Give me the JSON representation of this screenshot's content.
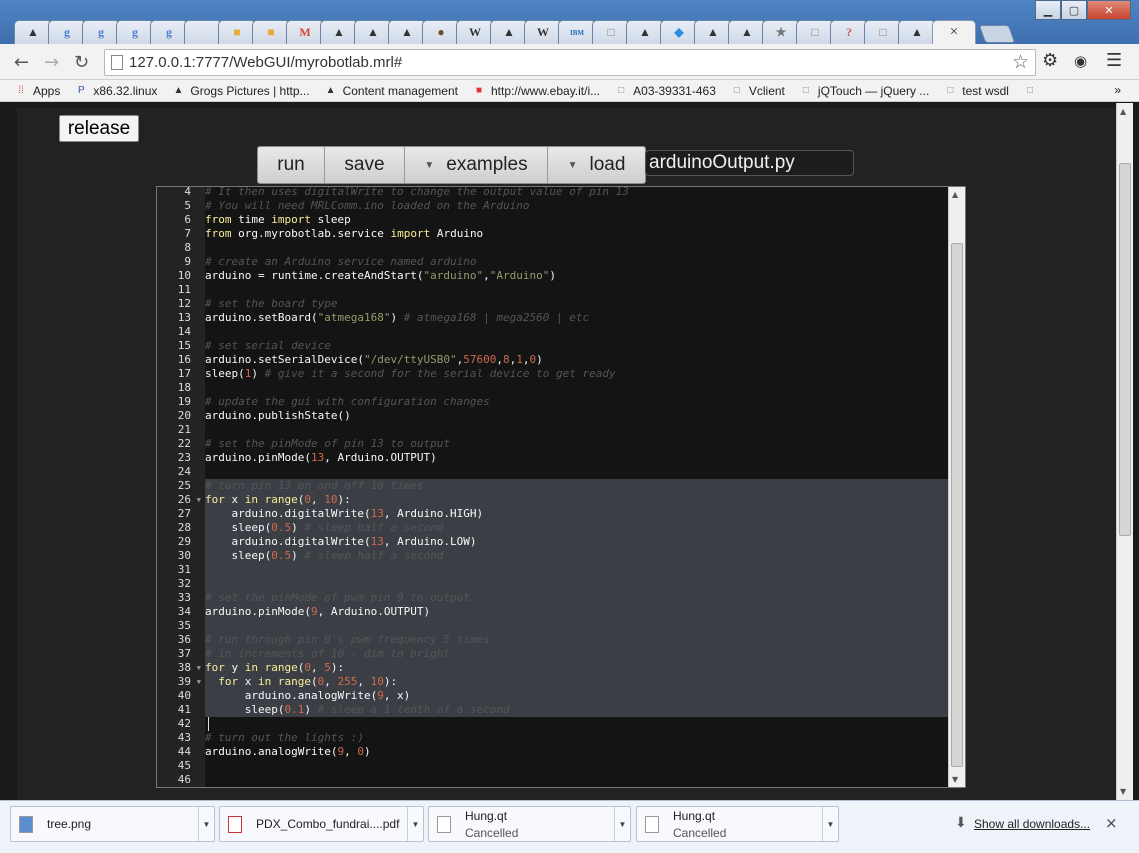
{
  "browser": {
    "tabs": [
      {
        "icon": "tophat-icon",
        "glyph": "▲",
        "color": "#333"
      },
      {
        "icon": "google-icon",
        "glyph": "g",
        "color": "#4a7fd8"
      },
      {
        "icon": "google-icon",
        "glyph": "g",
        "color": "#4a7fd8"
      },
      {
        "icon": "google-icon",
        "glyph": "g",
        "color": "#4a7fd8"
      },
      {
        "icon": "google-icon",
        "glyph": "g",
        "color": "#4a7fd8"
      },
      {
        "icon": "blank-icon",
        "glyph": "",
        "color": "#ccc"
      },
      {
        "icon": "box-icon",
        "glyph": "■",
        "color": "#e8a93a"
      },
      {
        "icon": "box-icon",
        "glyph": "■",
        "color": "#e8a93a"
      },
      {
        "icon": "gmail-icon",
        "glyph": "M",
        "color": "#d44638"
      },
      {
        "icon": "tophat-icon",
        "glyph": "▲",
        "color": "#333"
      },
      {
        "icon": "tophat-icon",
        "glyph": "▲",
        "color": "#333"
      },
      {
        "icon": "tophat-icon",
        "glyph": "▲",
        "color": "#333"
      },
      {
        "icon": "hedgehog-icon",
        "glyph": "●",
        "color": "#6b4a2a"
      },
      {
        "icon": "wikipedia-icon",
        "glyph": "W",
        "color": "#333"
      },
      {
        "icon": "tophat-icon",
        "glyph": "▲",
        "color": "#333"
      },
      {
        "icon": "wikipedia-icon",
        "glyph": "W",
        "color": "#333"
      },
      {
        "icon": "ibm-icon",
        "glyph": "IBM",
        "color": "#1f70c1"
      },
      {
        "icon": "page-icon",
        "glyph": "□",
        "color": "#888"
      },
      {
        "icon": "tophat-icon",
        "glyph": "▲",
        "color": "#333"
      },
      {
        "icon": "dropbox-icon",
        "glyph": "◆",
        "color": "#2a8ee0"
      },
      {
        "icon": "tophat-icon",
        "glyph": "▲",
        "color": "#333"
      },
      {
        "icon": "tophat-icon",
        "glyph": "▲",
        "color": "#333"
      },
      {
        "icon": "star-icon",
        "glyph": "★",
        "color": "#777"
      },
      {
        "icon": "page-icon",
        "glyph": "□",
        "color": "#888"
      },
      {
        "icon": "unknown-icon",
        "glyph": "?",
        "color": "#c55"
      },
      {
        "icon": "page-icon",
        "glyph": "□",
        "color": "#888"
      },
      {
        "icon": "tophat-icon",
        "glyph": "▲",
        "color": "#333"
      }
    ],
    "active_tab_close": "×",
    "url": "127.0.0.1:7777/WebGUI/myrobotlab.mrl#",
    "bookmarks": [
      {
        "icon": "apps-icon",
        "label": "Apps"
      },
      {
        "icon": "p-icon",
        "label": "x86.32.linux"
      },
      {
        "icon": "tophat-icon",
        "label": "Grogs Pictures | http..."
      },
      {
        "icon": "tophat-icon",
        "label": "Content management"
      },
      {
        "icon": "ebay-icon",
        "label": "http://www.ebay.it/i..."
      },
      {
        "icon": "page-icon",
        "label": "A03-39331-463"
      },
      {
        "icon": "page-icon",
        "label": "Vclient"
      },
      {
        "icon": "page-icon",
        "label": "jQTouch — jQuery ..."
      },
      {
        "icon": "page-icon",
        "label": "test wsdl"
      },
      {
        "icon": "page-icon",
        "label": ""
      }
    ],
    "bookmarks_more": "»"
  },
  "page": {
    "release_label": "release",
    "run_label": "run",
    "save_label": "save",
    "examples_label": "examples",
    "load_label": "load",
    "filename": "arduinoOutput.py"
  },
  "editor": {
    "cursor_line": 42,
    "lines": [
      {
        "n": 4,
        "sel": false,
        "fold": false,
        "toks": [
          [
            "c-com",
            "# It then uses digitalWrite to change the output value of pin 13"
          ]
        ]
      },
      {
        "n": 5,
        "sel": false,
        "fold": false,
        "toks": [
          [
            "c-com",
            "# You will need MRLComm.ino loaded on the Arduino"
          ]
        ]
      },
      {
        "n": 6,
        "sel": false,
        "fold": false,
        "toks": [
          [
            "c-kw",
            "from"
          ],
          [
            "c-id",
            " time "
          ],
          [
            "c-kw",
            "import"
          ],
          [
            "c-id",
            " sleep"
          ]
        ]
      },
      {
        "n": 7,
        "sel": false,
        "fold": false,
        "toks": [
          [
            "c-kw",
            "from"
          ],
          [
            "c-id",
            " org.myrobotlab.service "
          ],
          [
            "c-kw",
            "import"
          ],
          [
            "c-id",
            " Arduino"
          ]
        ]
      },
      {
        "n": 8,
        "sel": false,
        "fold": false,
        "toks": []
      },
      {
        "n": 9,
        "sel": false,
        "fold": false,
        "toks": [
          [
            "c-com",
            "# create an Arduino service named arduino"
          ]
        ]
      },
      {
        "n": 10,
        "sel": false,
        "fold": false,
        "toks": [
          [
            "c-id",
            "arduino = runtime.createAndStart("
          ],
          [
            "c-str",
            "\"arduino\""
          ],
          [
            "c-id",
            ","
          ],
          [
            "c-str",
            "\"Arduino\""
          ],
          [
            "c-id",
            ")"
          ]
        ]
      },
      {
        "n": 11,
        "sel": false,
        "fold": false,
        "toks": []
      },
      {
        "n": 12,
        "sel": false,
        "fold": false,
        "toks": [
          [
            "c-com",
            "# set the board type"
          ]
        ]
      },
      {
        "n": 13,
        "sel": false,
        "fold": false,
        "toks": [
          [
            "c-id",
            "arduino.setBoard("
          ],
          [
            "c-str",
            "\"atmega168\""
          ],
          [
            "c-id",
            ") "
          ],
          [
            "c-com",
            "# atmega168 | mega2560 | etc"
          ]
        ]
      },
      {
        "n": 14,
        "sel": false,
        "fold": false,
        "toks": []
      },
      {
        "n": 15,
        "sel": false,
        "fold": false,
        "toks": [
          [
            "c-com",
            "# set serial device"
          ]
        ]
      },
      {
        "n": 16,
        "sel": false,
        "fold": false,
        "toks": [
          [
            "c-id",
            "arduino.setSerialDevice("
          ],
          [
            "c-str",
            "\"/dev/ttyUSB0\""
          ],
          [
            "c-id",
            ","
          ],
          [
            "c-num",
            "57600"
          ],
          [
            "c-id",
            ","
          ],
          [
            "c-num",
            "8"
          ],
          [
            "c-id",
            ","
          ],
          [
            "c-num",
            "1"
          ],
          [
            "c-id",
            ","
          ],
          [
            "c-num",
            "0"
          ],
          [
            "c-id",
            ")"
          ]
        ]
      },
      {
        "n": 17,
        "sel": false,
        "fold": false,
        "toks": [
          [
            "c-id",
            "sleep("
          ],
          [
            "c-num",
            "1"
          ],
          [
            "c-id",
            ") "
          ],
          [
            "c-com",
            "# give it a second for the serial device to get ready"
          ]
        ]
      },
      {
        "n": 18,
        "sel": false,
        "fold": false,
        "toks": []
      },
      {
        "n": 19,
        "sel": false,
        "fold": false,
        "toks": [
          [
            "c-com",
            "# update the gui with configuration changes"
          ]
        ]
      },
      {
        "n": 20,
        "sel": false,
        "fold": false,
        "toks": [
          [
            "c-id",
            "arduino.publishState()"
          ]
        ]
      },
      {
        "n": 21,
        "sel": false,
        "fold": false,
        "toks": []
      },
      {
        "n": 22,
        "sel": false,
        "fold": false,
        "toks": [
          [
            "c-com",
            "# set the pinMode of pin 13 to output"
          ]
        ]
      },
      {
        "n": 23,
        "sel": false,
        "fold": false,
        "toks": [
          [
            "c-id",
            "arduino.pinMode("
          ],
          [
            "c-num",
            "13"
          ],
          [
            "c-id",
            ", Arduino.OUTPUT)"
          ]
        ]
      },
      {
        "n": 24,
        "sel": false,
        "fold": false,
        "toks": []
      },
      {
        "n": 25,
        "sel": true,
        "fold": false,
        "toks": [
          [
            "c-com",
            "# turn pin 13 on and off 10 times"
          ]
        ]
      },
      {
        "n": 26,
        "sel": true,
        "fold": true,
        "toks": [
          [
            "c-kw",
            "for"
          ],
          [
            "c-id",
            " x "
          ],
          [
            "c-kw",
            "in"
          ],
          [
            "c-id",
            " "
          ],
          [
            "c-kw",
            "range"
          ],
          [
            "c-id",
            "("
          ],
          [
            "c-num",
            "0"
          ],
          [
            "c-id",
            ", "
          ],
          [
            "c-num",
            "10"
          ],
          [
            "c-id",
            "):"
          ]
        ]
      },
      {
        "n": 27,
        "sel": true,
        "fold": false,
        "toks": [
          [
            "c-id",
            "    arduino.digitalWrite("
          ],
          [
            "c-num",
            "13"
          ],
          [
            "c-id",
            ", Arduino.HIGH)"
          ]
        ]
      },
      {
        "n": 28,
        "sel": true,
        "fold": false,
        "toks": [
          [
            "c-id",
            "    sleep("
          ],
          [
            "c-num",
            "0.5"
          ],
          [
            "c-id",
            ") "
          ],
          [
            "c-com",
            "# sleep half a second"
          ]
        ]
      },
      {
        "n": 29,
        "sel": true,
        "fold": false,
        "toks": [
          [
            "c-id",
            "    arduino.digitalWrite("
          ],
          [
            "c-num",
            "13"
          ],
          [
            "c-id",
            ", Arduino.LOW)"
          ]
        ]
      },
      {
        "n": 30,
        "sel": true,
        "fold": false,
        "toks": [
          [
            "c-id",
            "    sleep("
          ],
          [
            "c-num",
            "0.5"
          ],
          [
            "c-id",
            ") "
          ],
          [
            "c-com",
            "# sleep half a second"
          ]
        ]
      },
      {
        "n": 31,
        "sel": true,
        "fold": false,
        "toks": []
      },
      {
        "n": 32,
        "sel": true,
        "fold": false,
        "toks": []
      },
      {
        "n": 33,
        "sel": true,
        "fold": false,
        "toks": [
          [
            "c-com",
            "# set the pinMode of pwm pin 9 to output"
          ]
        ]
      },
      {
        "n": 34,
        "sel": true,
        "fold": false,
        "toks": [
          [
            "c-id",
            "arduino.pinMode("
          ],
          [
            "c-num",
            "9"
          ],
          [
            "c-id",
            ", Arduino.OUTPUT)"
          ]
        ]
      },
      {
        "n": 35,
        "sel": true,
        "fold": false,
        "toks": []
      },
      {
        "n": 36,
        "sel": true,
        "fold": false,
        "toks": [
          [
            "c-com",
            "# run through pin 9's pwm frequency 5 times"
          ]
        ]
      },
      {
        "n": 37,
        "sel": true,
        "fold": false,
        "toks": [
          [
            "c-com",
            "# in increments of 10 - dim to bright"
          ]
        ]
      },
      {
        "n": 38,
        "sel": true,
        "fold": true,
        "toks": [
          [
            "c-kw",
            "for"
          ],
          [
            "c-id",
            " y "
          ],
          [
            "c-kw",
            "in"
          ],
          [
            "c-id",
            " "
          ],
          [
            "c-kw",
            "range"
          ],
          [
            "c-id",
            "("
          ],
          [
            "c-num",
            "0"
          ],
          [
            "c-id",
            ", "
          ],
          [
            "c-num",
            "5"
          ],
          [
            "c-id",
            "):"
          ]
        ]
      },
      {
        "n": 39,
        "sel": true,
        "fold": true,
        "toks": [
          [
            "c-id",
            "  "
          ],
          [
            "c-kw",
            "for"
          ],
          [
            "c-id",
            " x "
          ],
          [
            "c-kw",
            "in"
          ],
          [
            "c-id",
            " "
          ],
          [
            "c-kw",
            "range"
          ],
          [
            "c-id",
            "("
          ],
          [
            "c-num",
            "0"
          ],
          [
            "c-id",
            ", "
          ],
          [
            "c-num",
            "255"
          ],
          [
            "c-id",
            ", "
          ],
          [
            "c-num",
            "10"
          ],
          [
            "c-id",
            "):"
          ]
        ]
      },
      {
        "n": 40,
        "sel": true,
        "fold": false,
        "toks": [
          [
            "c-id",
            "      arduino.analogWrite("
          ],
          [
            "c-num",
            "9"
          ],
          [
            "c-id",
            ", x)"
          ]
        ]
      },
      {
        "n": 41,
        "sel": true,
        "fold": false,
        "toks": [
          [
            "c-id",
            "      sleep("
          ],
          [
            "c-num",
            "0.1"
          ],
          [
            "c-id",
            ") "
          ],
          [
            "c-com",
            "# sleep a 1 tenth of a second"
          ]
        ]
      },
      {
        "n": 42,
        "sel": false,
        "fold": false,
        "toks": []
      },
      {
        "n": 43,
        "sel": false,
        "fold": false,
        "toks": [
          [
            "c-com",
            "# turn out the lights :)"
          ]
        ]
      },
      {
        "n": 44,
        "sel": false,
        "fold": false,
        "toks": [
          [
            "c-id",
            "arduino.analogWrite("
          ],
          [
            "c-num",
            "9"
          ],
          [
            "c-id",
            ", "
          ],
          [
            "c-num",
            "0"
          ],
          [
            "c-id",
            ")"
          ]
        ]
      },
      {
        "n": 45,
        "sel": false,
        "fold": false,
        "toks": []
      },
      {
        "n": 46,
        "sel": false,
        "fold": false,
        "toks": []
      }
    ]
  },
  "downloads": {
    "items": [
      {
        "name": "tree.png",
        "status": "",
        "icon": "image-file-icon"
      },
      {
        "name": "PDX_Combo_fundrai....pdf",
        "status": "",
        "icon": "pdf-file-icon"
      },
      {
        "name": "Hung.qt",
        "status": "Cancelled",
        "icon": "file-icon"
      },
      {
        "name": "Hung.qt",
        "status": "Cancelled",
        "icon": "file-icon"
      }
    ],
    "show_all": "Show all downloads...",
    "close_glyph": "×"
  }
}
